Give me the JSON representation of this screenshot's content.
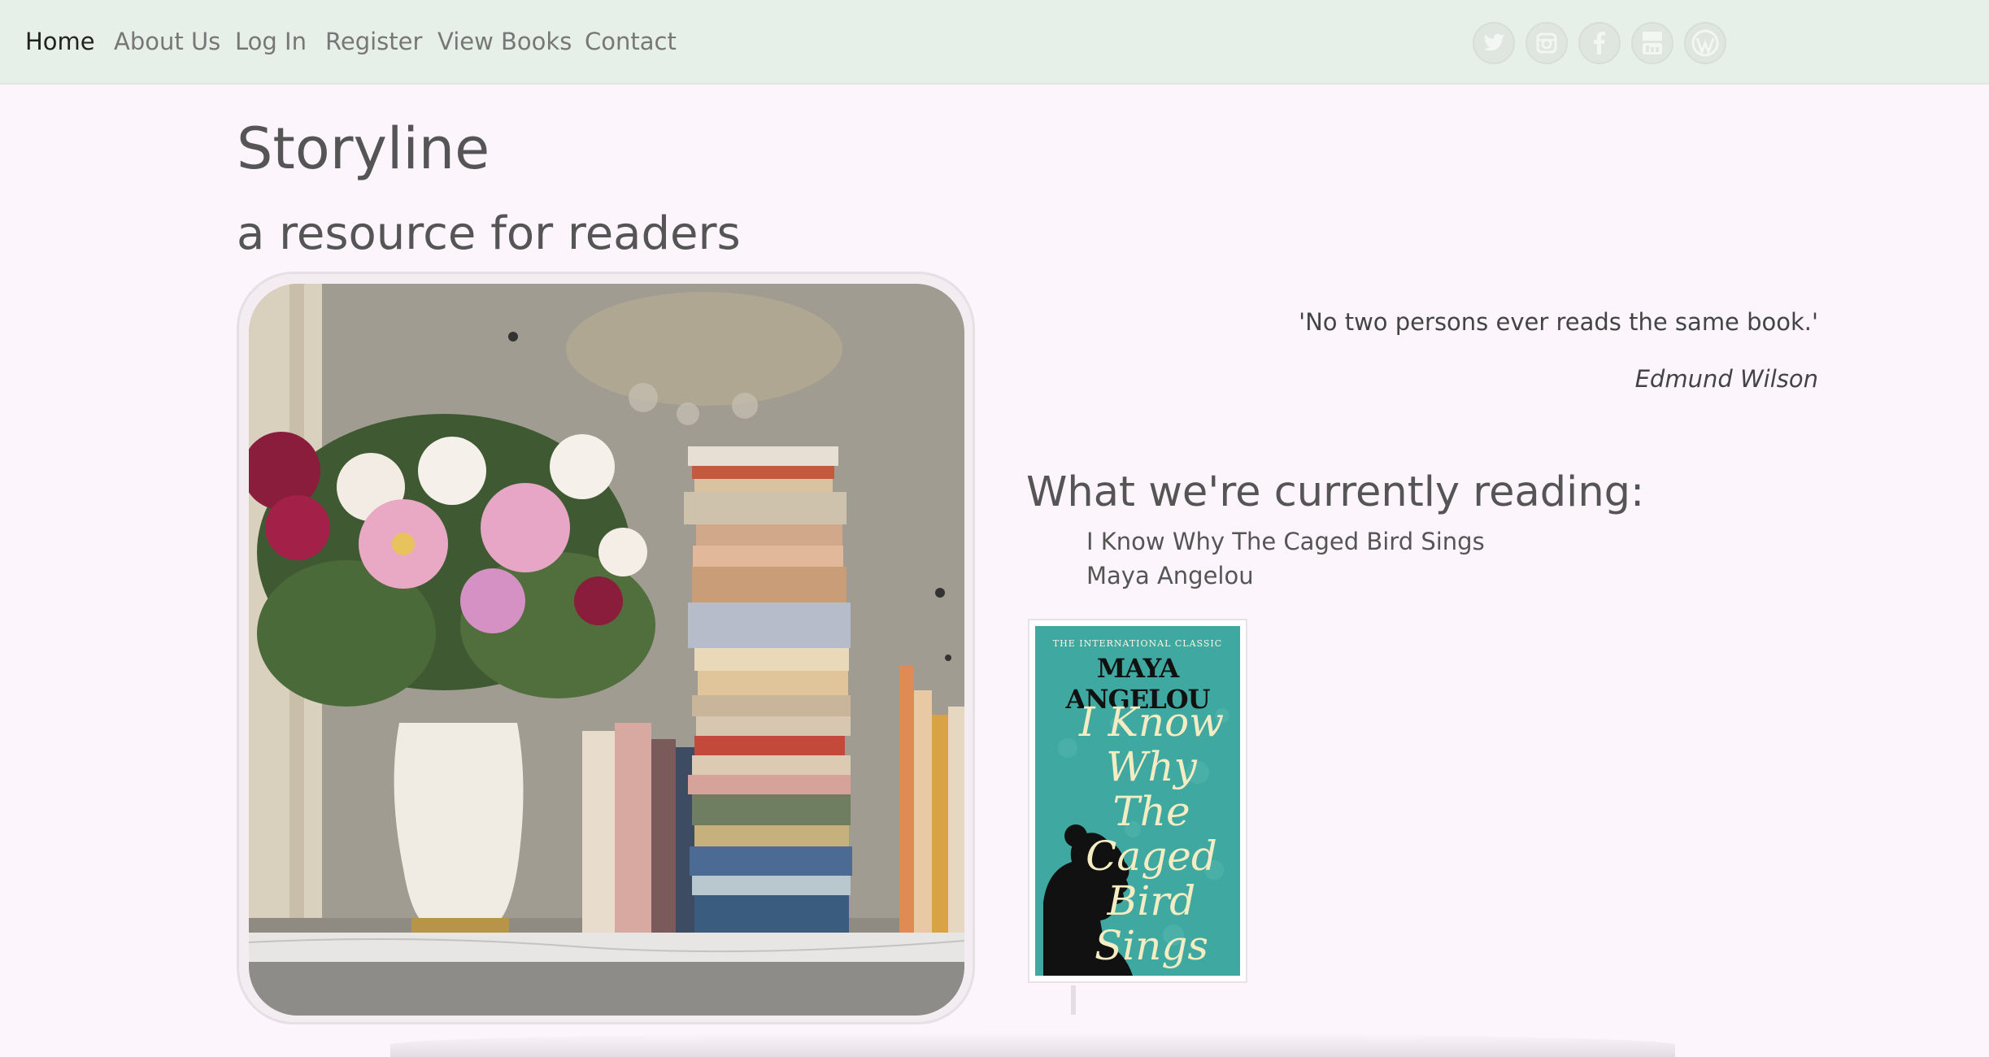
{
  "nav": {
    "links": [
      "Home",
      "About Us",
      "Log In",
      "Register",
      "View Books",
      "Contact"
    ],
    "active": "Home"
  },
  "social_icons": [
    "twitter-icon",
    "instagram-icon",
    "facebook-icon",
    "youtube-icon",
    "wordpress-icon"
  ],
  "site": {
    "title": "Storyline",
    "tagline": "a resource for readers"
  },
  "quote": {
    "text": "'No two persons ever reads the same book.'",
    "author": "Edmund Wilson"
  },
  "currently_reading": {
    "heading": "What we're currently reading:",
    "book_title": "I Know Why The Caged Bird Sings",
    "book_author": "Maya Angelou",
    "cover": {
      "series": "THE INTERNATIONAL CLASSIC",
      "author": "MAYA ANGELOU",
      "title": "I Know Why The Caged Bird Sings"
    }
  },
  "colors": {
    "page_background": "#fdf5fc",
    "navbar_background": "#e7f0e8",
    "cover_teal": "#3fa8a0"
  }
}
